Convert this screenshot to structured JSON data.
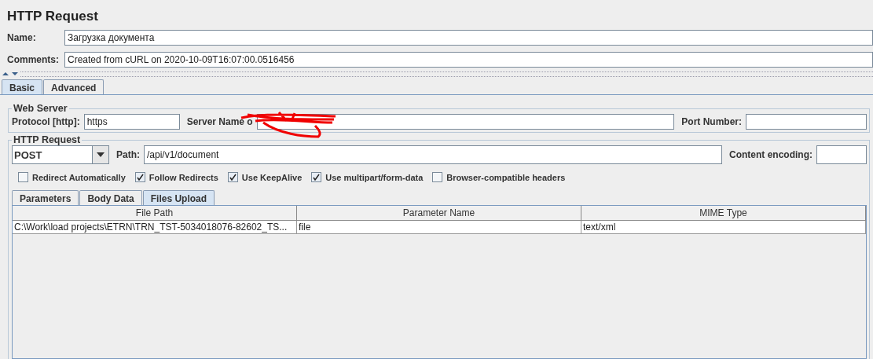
{
  "title": "HTTP Request",
  "name": {
    "label": "Name:",
    "value": "Загрузка документа"
  },
  "comments": {
    "label": "Comments:",
    "value": "Created from cURL on 2020-10-09T16:07:00.0516456"
  },
  "tabs": [
    {
      "label": "Basic",
      "selected": true
    },
    {
      "label": "Advanced",
      "selected": false
    }
  ],
  "web_server": {
    "title": "Web Server",
    "protocol_label": "Protocol [http]:",
    "protocol": "https",
    "server_label": "Server Name o",
    "port_label": "Port Number:"
  },
  "http_request": {
    "title": "HTTP Request",
    "method": "POST",
    "path_label": "Path:",
    "path": "/api/v1/document",
    "encoding_label": "Content encoding:"
  },
  "options": [
    {
      "label": "Redirect Automatically",
      "checked": false
    },
    {
      "label": "Follow Redirects",
      "checked": true
    },
    {
      "label": "Use KeepAlive",
      "checked": true
    },
    {
      "label": "Use multipart/form-data",
      "checked": true
    },
    {
      "label": "Browser-compatible headers",
      "checked": false
    }
  ],
  "sub_tabs": [
    {
      "label": "Parameters",
      "selected": false
    },
    {
      "label": "Body Data",
      "selected": false
    },
    {
      "label": "Files Upload",
      "selected": true
    }
  ],
  "table": {
    "columns": [
      "File Path",
      "Parameter Name",
      "MIME Type"
    ],
    "rows": [
      [
        "C:\\Work\\load projects\\ETRN\\TRN_TST-5034018076-82602_TS...",
        "file",
        "text/xml"
      ]
    ]
  }
}
